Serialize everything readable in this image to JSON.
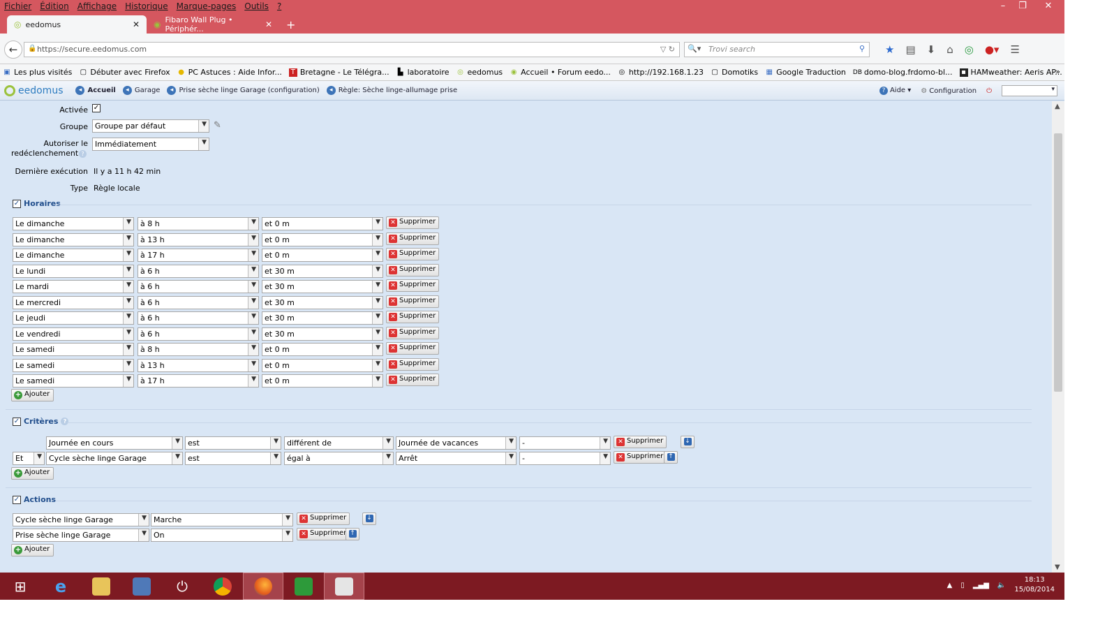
{
  "menu": [
    "Fichier",
    "Édition",
    "Affichage",
    "Historique",
    "Marque-pages",
    "Outils",
    "?"
  ],
  "window_controls": {
    "minimize": "–",
    "restore": "❐",
    "close": "✕"
  },
  "tabs": [
    {
      "title": "eedomus",
      "active": true
    },
    {
      "title": "Fibaro Wall Plug • Périphér...",
      "active": false
    }
  ],
  "url": "https://secure.eedomus.com",
  "search_placeholder": "Trovi search",
  "bookmarks": [
    "Les plus visités",
    "Débuter avec Firefox",
    "PC Astuces : Aide Infor...",
    "Bretagne - Le Télégra...",
    "laboratoire",
    "eedomus",
    "Accueil • Forum eedo...",
    "http://192.168.1.23",
    "Domotiks",
    "Google Traduction",
    "domo-blog.frdomo-bl...",
    "HAMweather: Aeris AP..."
  ],
  "app": {
    "logo": "eedomus",
    "breadcrumbs": [
      "Accueil",
      "Garage",
      "Prise sèche linge Garage (configuration)",
      "Règle: Sèche linge-allumage prise"
    ],
    "help_label": "Aide",
    "config_label": "Configuration"
  },
  "form": {
    "active_label": "Activée",
    "group_label": "Groupe",
    "group_value": "Groupe par défaut",
    "retrigger_label_1": "Autoriser le",
    "retrigger_label_2": "redéclenchement",
    "retrigger_value": "Immédiatement",
    "last_exec_label": "Dernière exécution",
    "last_exec_value": "Il y a 11 h 42 min",
    "type_label": "Type",
    "type_value": "Règle locale"
  },
  "horaires": {
    "title": "Horaires",
    "delete_label": "Supprimer",
    "add_label": "Ajouter",
    "rows": [
      {
        "day": "Le dimanche",
        "hour": "à 8 h",
        "minute": "et 0 m"
      },
      {
        "day": "Le dimanche",
        "hour": "à 13 h",
        "minute": "et 0 m"
      },
      {
        "day": "Le dimanche",
        "hour": "à 17 h",
        "minute": "et 0 m"
      },
      {
        "day": "Le lundi",
        "hour": "à 6 h",
        "minute": "et 30 m"
      },
      {
        "day": "Le mardi",
        "hour": "à 6 h",
        "minute": "et 30 m"
      },
      {
        "day": "Le mercredi",
        "hour": "à 6 h",
        "minute": "et 30 m"
      },
      {
        "day": "Le jeudi",
        "hour": "à 6 h",
        "minute": "et 30 m"
      },
      {
        "day": "Le vendredi",
        "hour": "à 6 h",
        "minute": "et 30 m"
      },
      {
        "day": "Le samedi",
        "hour": "à 8 h",
        "minute": "et 0 m"
      },
      {
        "day": "Le samedi",
        "hour": "à 13 h",
        "minute": "et 0 m"
      },
      {
        "day": "Le samedi",
        "hour": "à 17 h",
        "minute": "et 0 m"
      }
    ]
  },
  "criteres": {
    "title": "Critères",
    "delete_label": "Supprimer",
    "add_label": "Ajouter",
    "rows": [
      {
        "op": "",
        "subject": "Journée en cours",
        "verb": "est",
        "comparator": "différent de",
        "value": "Journée de vacances",
        "extra": "-"
      },
      {
        "op": "Et",
        "subject": "Cycle sèche linge Garage",
        "verb": "est",
        "comparator": "égal à",
        "value": "Arrêt",
        "extra": "-"
      }
    ]
  },
  "actions": {
    "title": "Actions",
    "delete_label": "Supprimer",
    "add_label": "Ajouter",
    "rows": [
      {
        "device": "Cycle sèche linge Garage",
        "value": "Marche"
      },
      {
        "device": "Prise sèche linge Garage",
        "value": "On"
      }
    ]
  },
  "taskbar": {
    "time": "18:13",
    "date": "15/08/2014"
  }
}
